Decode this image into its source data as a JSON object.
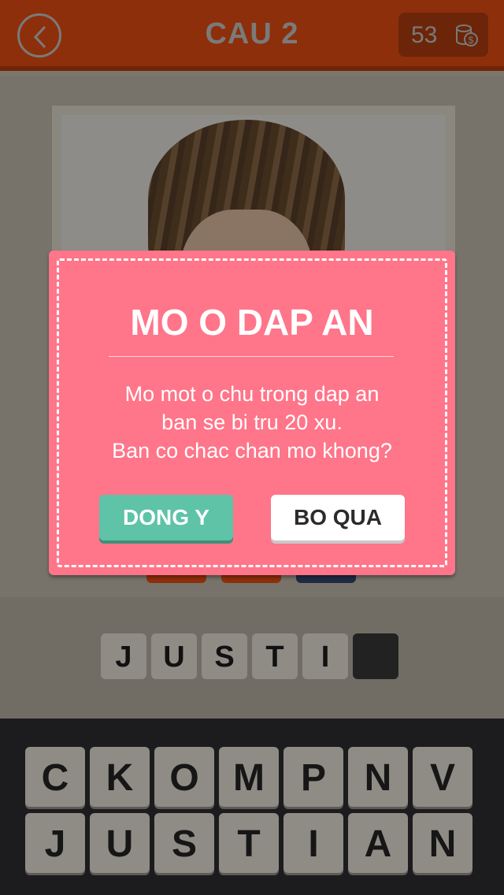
{
  "header": {
    "title": "CAU 2",
    "coins": "53"
  },
  "answer": {
    "slots": [
      "J",
      "U",
      "S",
      "T",
      "I",
      ""
    ]
  },
  "keyboard": {
    "row1": [
      "C",
      "K",
      "O",
      "M",
      "P",
      "N",
      "V"
    ],
    "row2": [
      "J",
      "U",
      "S",
      "T",
      "I",
      "A",
      "N"
    ]
  },
  "dialog": {
    "title": "MO O DAP AN",
    "message_lines": [
      "Mo mot o chu trong dap an",
      "ban se bi tru 20 xu.",
      "Ban co chac chan mo khong?"
    ],
    "confirm_label": "DONG Y",
    "cancel_label": "BO QUA"
  },
  "colors": {
    "header_bg": "#8e2f0b",
    "dialog_bg": "#ff7589",
    "confirm_bg": "#5ec3a7",
    "cancel_bg": "#ffffff",
    "keyboard_bg": "#1c1c1f"
  },
  "icons": {
    "back": "chevron-left-icon",
    "coin": "coin-stack-icon"
  }
}
